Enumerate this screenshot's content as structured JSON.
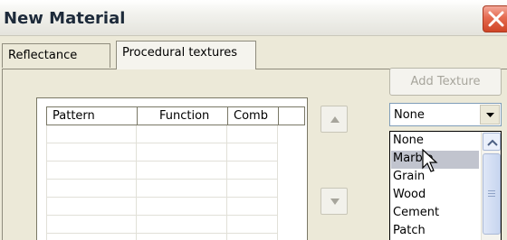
{
  "window": {
    "title": "New Material",
    "close_icon": "close-icon"
  },
  "tabs": [
    {
      "label": "Reflectance",
      "active": false
    },
    {
      "label": "Procedural textures",
      "active": true
    }
  ],
  "grid": {
    "columns": [
      "Pattern",
      "Function",
      "Comb",
      ""
    ],
    "rows": [
      [
        "",
        "",
        ""
      ],
      [
        "",
        "",
        ""
      ],
      [
        "",
        "",
        ""
      ],
      [
        "",
        "",
        ""
      ],
      [
        "",
        "",
        ""
      ],
      [
        "",
        "",
        ""
      ],
      [
        "",
        "",
        ""
      ]
    ]
  },
  "buttons": {
    "add_texture": "Add Texture",
    "move_up_icon": "triangle-up-icon",
    "move_down_icon": "triangle-down-icon"
  },
  "combo": {
    "selected": "None",
    "open": true,
    "options": [
      "None",
      "Marble",
      "Grain",
      "Wood",
      "Cement",
      "Patch"
    ],
    "highlighted": "Marble"
  },
  "colors": {
    "highlight": "#c1c4ce",
    "close_button": "#e56a4f",
    "disabled_text": "#a7a59c"
  }
}
